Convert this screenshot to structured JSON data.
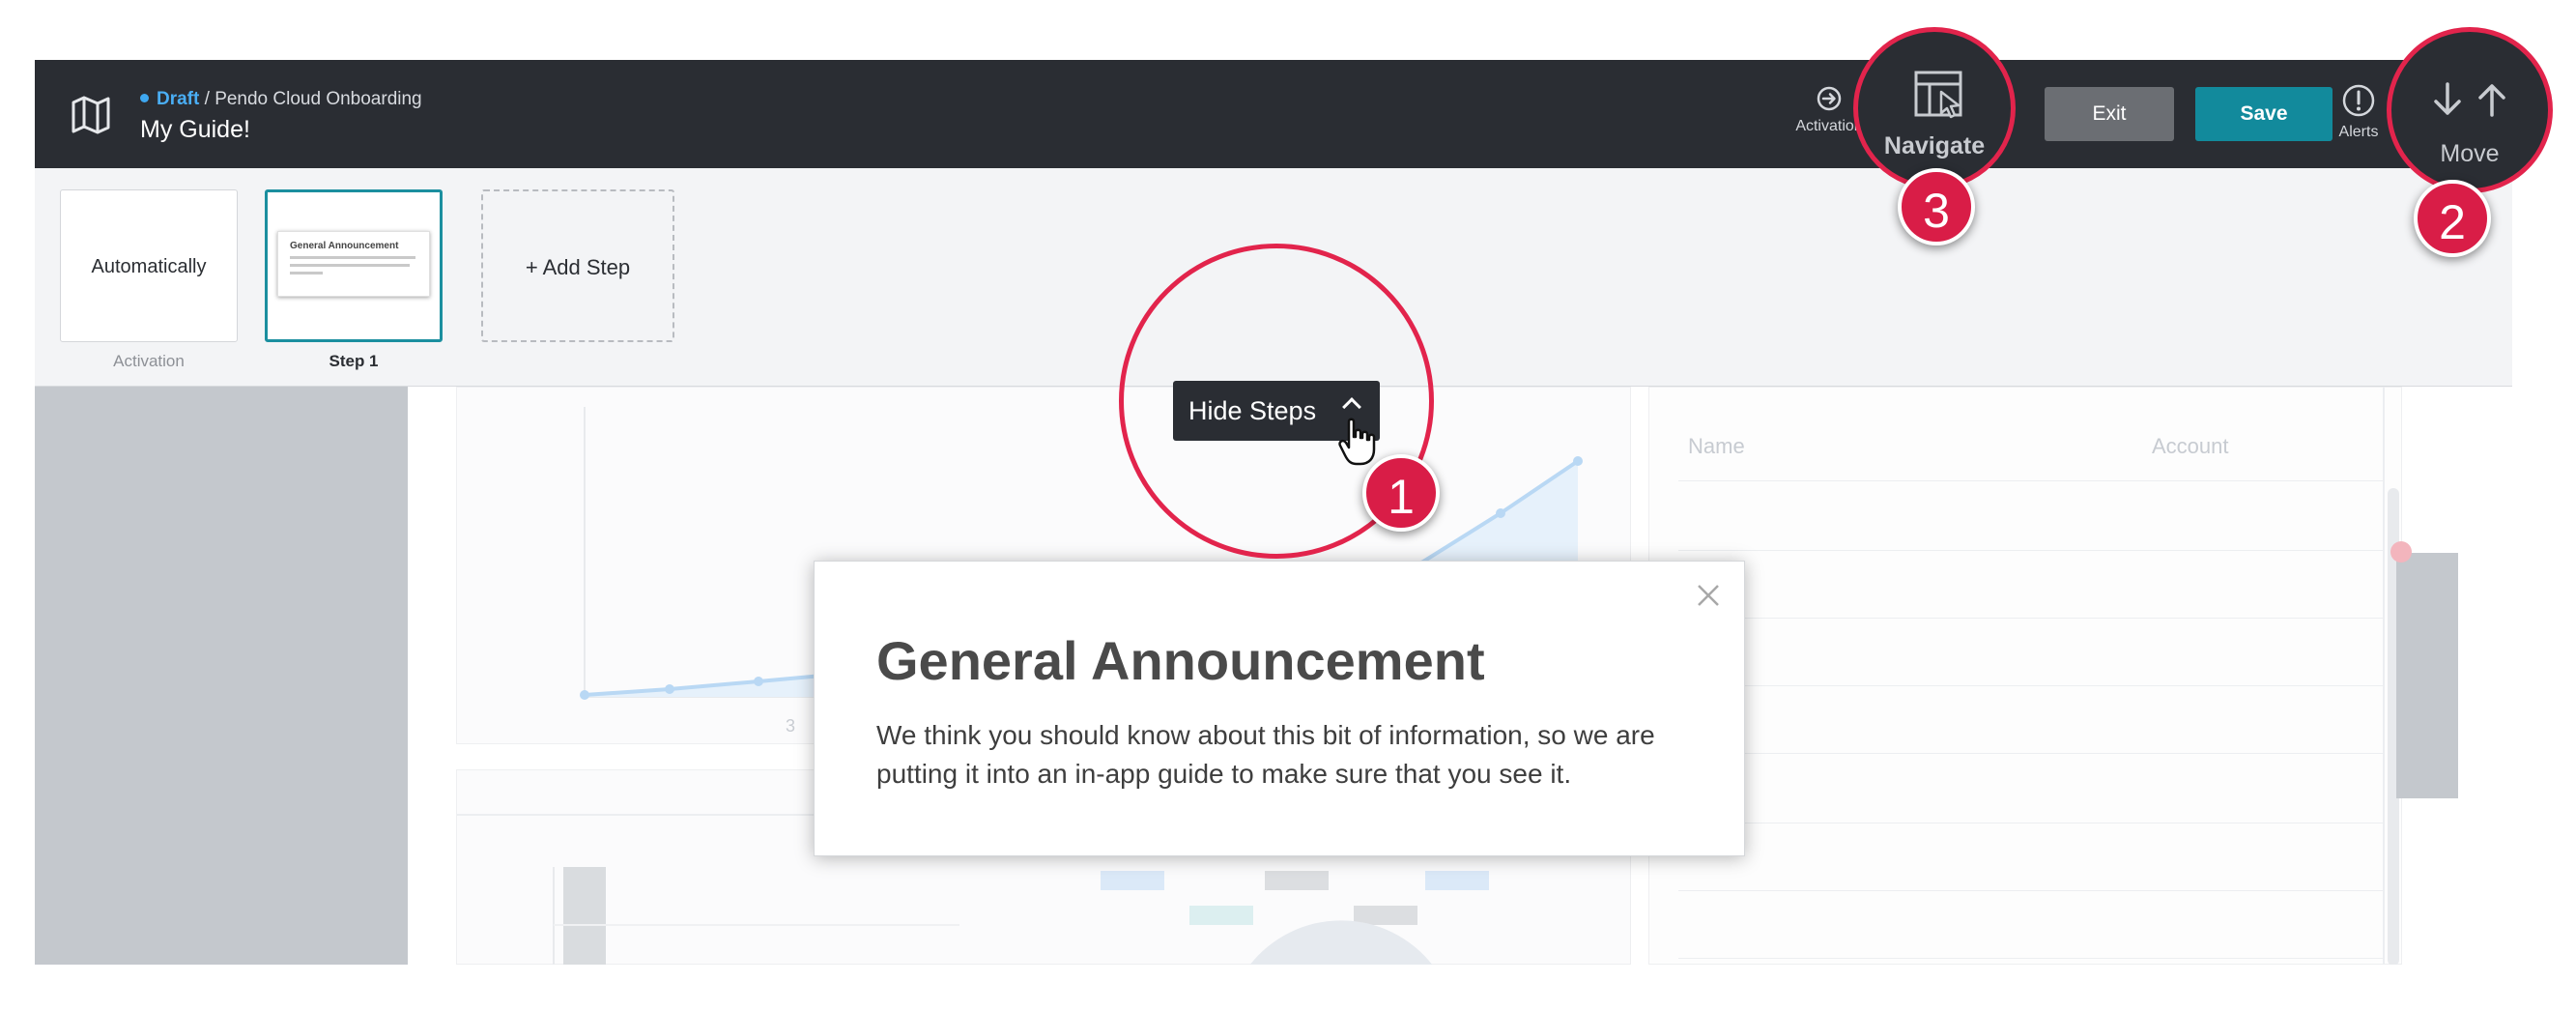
{
  "header": {
    "status": "Draft",
    "separator": "/",
    "app_name": "Pendo Cloud Onboarding",
    "guide_title": "My Guide!",
    "activation_label": "Activation",
    "navigate_label": "Navigate",
    "exit_label": "Exit",
    "save_label": "Save",
    "alerts_label": "Alerts",
    "move_label": "Move"
  },
  "steps": {
    "items": [
      {
        "card_text": "Automatically",
        "caption": "Activation"
      },
      {
        "card_text": "General Announcement",
        "caption": "Step 1"
      }
    ],
    "add_step_label": "+ Add Step",
    "hide_steps_label": "Hide Steps"
  },
  "background_app": {
    "table_headers": [
      "Name",
      "Account"
    ],
    "chart_tick": "3"
  },
  "modal": {
    "title": "General Announcement",
    "body": "We think you should know about this bit of information, so we are putting it into an in-app guide to make sure that you see it."
  },
  "annotations": [
    "1",
    "2",
    "3"
  ],
  "colors": {
    "topbar": "#2a2d33",
    "accent_teal": "#128a9c",
    "draft_blue": "#3ea7f0",
    "annotation_red": "#e2244c"
  },
  "icons": [
    "map-icon",
    "activation-icon",
    "navigate-icon",
    "alert-icon",
    "move-down-icon",
    "move-up-icon",
    "close-icon",
    "chevron-up-icon",
    "hand-cursor-icon"
  ]
}
